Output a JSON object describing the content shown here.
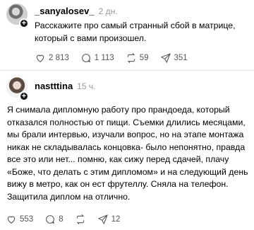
{
  "posts": [
    {
      "username": "_sanyalosev_",
      "time": "2 дн.",
      "text": "Расскажите про самый странный сбой в матрице, который с вами произошел.",
      "likes": "2 813",
      "comments": "1 113",
      "reposts": "59",
      "shares": "351"
    },
    {
      "username": "nastttina",
      "time": "15 ч.",
      "text": "Я снимала дипломную работу про прандоеда, который отказался полностью от пищи. Съемки длились месяцами, мы брали интервью, изучали вопрос, но на этапе монтажа никак не складывалась концовка- было непонятно, правда все это или нет... помню, как сижу перед сдачей, плачу «Боже, что делать с этим дипломом» и на следующий день вижу в метро, как он ест фрутеллу. Сняла на телефон. Защитила диплом на отлично.",
      "likes": "553",
      "comments": "8",
      "reposts": "",
      "shares": "12"
    }
  ],
  "icons": {
    "like": "heart-icon",
    "comment": "comment-icon",
    "repost": "repost-icon",
    "share": "share-icon"
  }
}
